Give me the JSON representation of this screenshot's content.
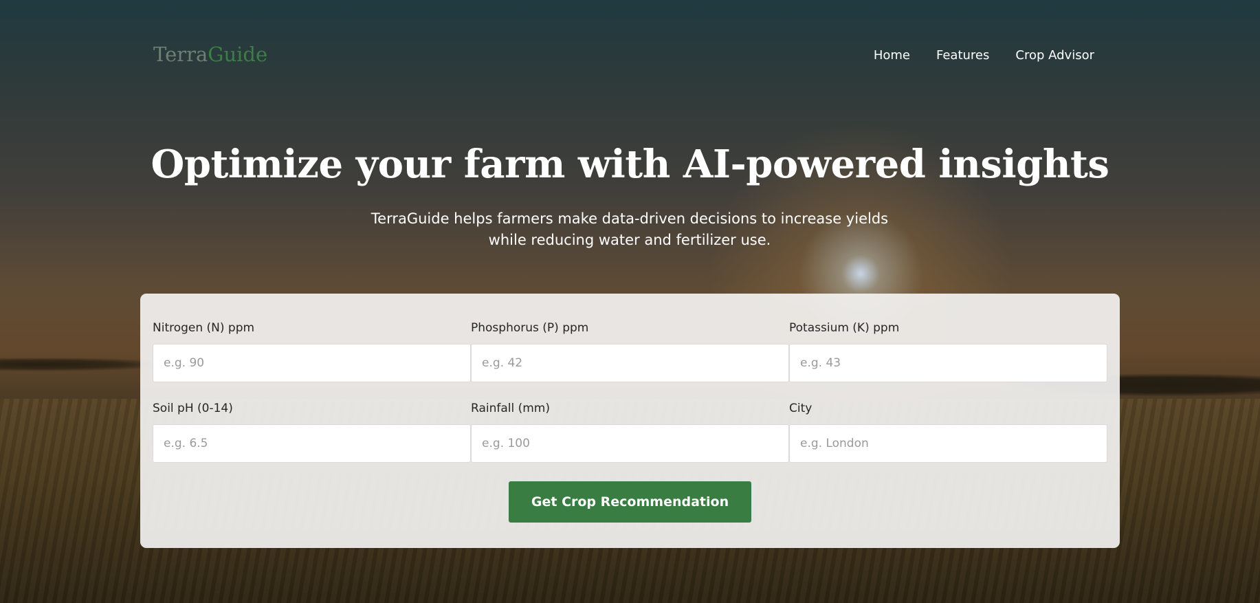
{
  "brand": {
    "name_part1": "Terra",
    "name_part2": "Guide"
  },
  "nav": {
    "items": [
      {
        "label": "Home"
      },
      {
        "label": "Features"
      },
      {
        "label": "Crop Advisor"
      }
    ]
  },
  "hero": {
    "headline": "Optimize your farm with AI-powered insights",
    "subtitle_line1": "TerraGuide helps farmers make data-driven decisions to increase yields",
    "subtitle_line2": "while reducing water and fertilizer use."
  },
  "form": {
    "fields": [
      {
        "label": "Nitrogen (N) ppm",
        "placeholder": "e.g. 90"
      },
      {
        "label": "Phosphorus (P) ppm",
        "placeholder": "e.g. 42"
      },
      {
        "label": "Potassium (K) ppm",
        "placeholder": "e.g. 43"
      },
      {
        "label": "Soil pH (0-14)",
        "placeholder": "e.g. 6.5"
      },
      {
        "label": "Rainfall (mm)",
        "placeholder": "e.g. 100"
      },
      {
        "label": "City",
        "placeholder": "e.g. London"
      }
    ],
    "submit_label": "Get Crop Recommendation"
  },
  "colors": {
    "brand_green": "#3a7d43",
    "logo_gray": "#6f7f73",
    "card_background": "#f2f1f0"
  }
}
